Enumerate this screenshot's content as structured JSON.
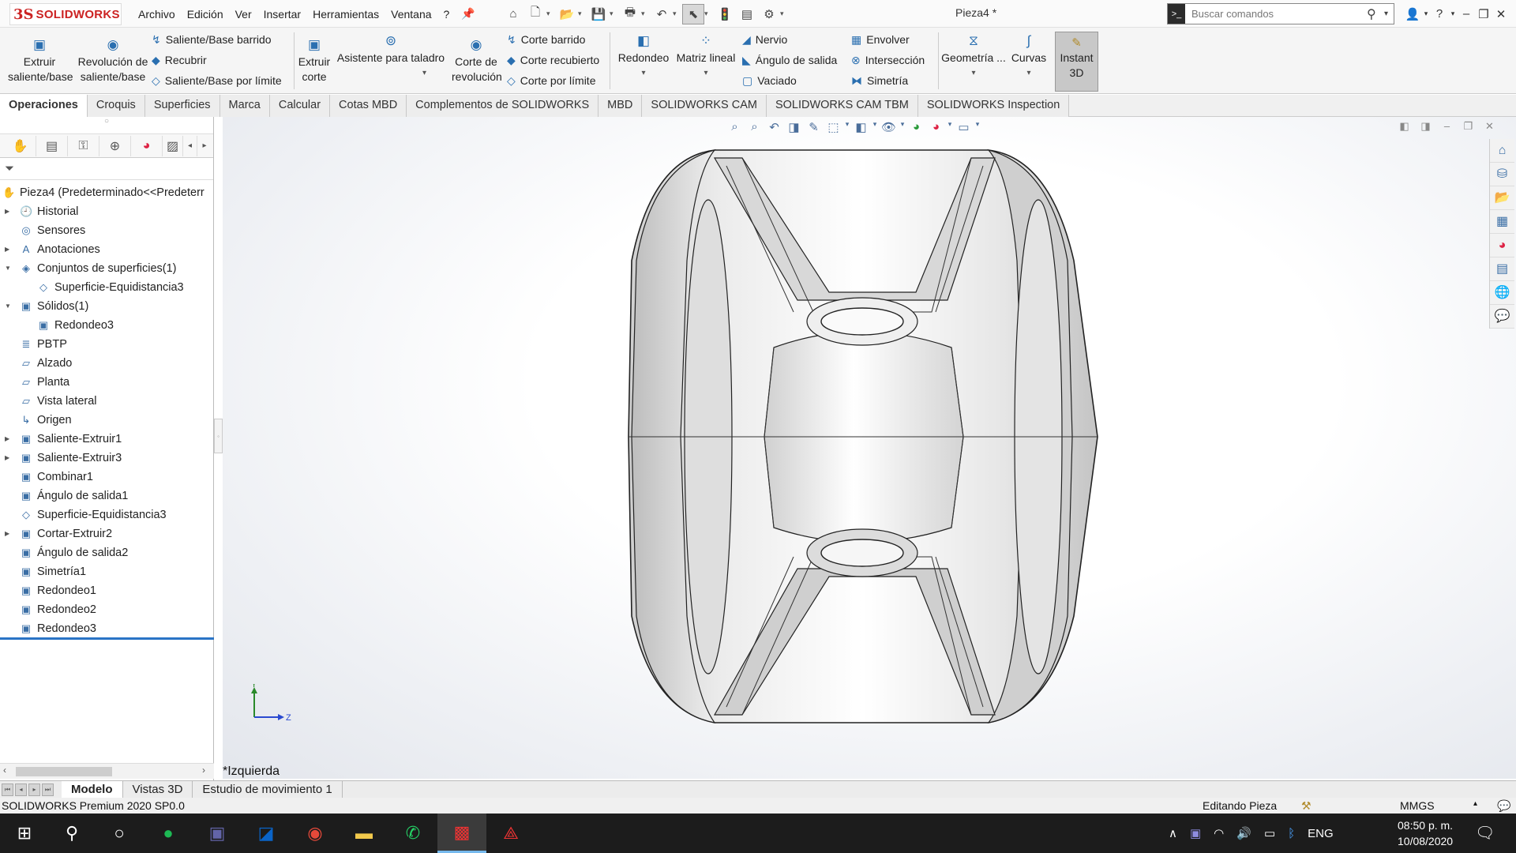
{
  "app": {
    "logo_ds": "3S",
    "logo_text": "SOLIDWORKS",
    "document_title": "Pieza4 *",
    "menus": [
      "Archivo",
      "Edición",
      "Ver",
      "Insertar",
      "Herramientas",
      "Ventana",
      "?"
    ],
    "search_placeholder": "Buscar comandos"
  },
  "command_manager": {
    "extruir": "Extruir saliente/base",
    "revolucion": "Revolución de saliente/base",
    "saliente_barrido": "Saliente/Base barrido",
    "recubrir": "Recubrir",
    "saliente_limite": "Saliente/Base por límite",
    "extruir_corte": "Extruir corte",
    "asistente": "Asistente para taladro",
    "corte_revolucion": "Corte de revolución",
    "corte_barrido": "Corte barrido",
    "corte_recubierto": "Corte recubierto",
    "corte_limite": "Corte por límite",
    "redondeo": "Redondeo",
    "matriz": "Matriz lineal",
    "nervio": "Nervio",
    "angulo_salida": "Ángulo de salida",
    "vaciado": "Vaciado",
    "envolver": "Envolver",
    "interseccion": "Intersección",
    "simetria": "Simetría",
    "geometria": "Geometría ...",
    "curvas": "Curvas",
    "instant3d": "Instant 3D"
  },
  "tabs": [
    "Operaciones",
    "Croquis",
    "Superficies",
    "Marca",
    "Calcular",
    "Cotas MBD",
    "Complementos de SOLIDWORKS",
    "MBD",
    "SOLIDWORKS CAM",
    "SOLIDWORKS CAM TBM",
    "SOLIDWORKS Inspection"
  ],
  "tree": {
    "root": "Pieza4  (Predeterminado<<Predeterr",
    "items": [
      {
        "label": "Historial",
        "arrow": "▶",
        "indent": 0
      },
      {
        "label": "Sensores",
        "arrow": "",
        "indent": 0
      },
      {
        "label": "Anotaciones",
        "arrow": "▶",
        "indent": 0
      },
      {
        "label": "Conjuntos de superficies(1)",
        "arrow": "▼",
        "indent": 0
      },
      {
        "label": "Superficie-Equidistancia3",
        "arrow": "",
        "indent": 1
      },
      {
        "label": "Sólidos(1)",
        "arrow": "▼",
        "indent": 0
      },
      {
        "label": "Redondeo3",
        "arrow": "",
        "indent": 1
      },
      {
        "label": "PBTP",
        "arrow": "",
        "indent": 0
      },
      {
        "label": "Alzado",
        "arrow": "",
        "indent": 0
      },
      {
        "label": "Planta",
        "arrow": "",
        "indent": 0
      },
      {
        "label": "Vista lateral",
        "arrow": "",
        "indent": 0
      },
      {
        "label": "Origen",
        "arrow": "",
        "indent": 0
      },
      {
        "label": "Saliente-Extruir1",
        "arrow": "▶",
        "indent": 0
      },
      {
        "label": "Saliente-Extruir3",
        "arrow": "▶",
        "indent": 0
      },
      {
        "label": "Combinar1",
        "arrow": "",
        "indent": 0
      },
      {
        "label": "Ángulo de salida1",
        "arrow": "",
        "indent": 0
      },
      {
        "label": "Superficie-Equidistancia3",
        "arrow": "",
        "indent": 0
      },
      {
        "label": "Cortar-Extruir2",
        "arrow": "▶",
        "indent": 0
      },
      {
        "label": "Ángulo de salida2",
        "arrow": "",
        "indent": 0
      },
      {
        "label": "Simetría1",
        "arrow": "",
        "indent": 0
      },
      {
        "label": "Redondeo1",
        "arrow": "",
        "indent": 0
      },
      {
        "label": "Redondeo2",
        "arrow": "",
        "indent": 0
      },
      {
        "label": "Redondeo3",
        "arrow": "",
        "indent": 0
      }
    ]
  },
  "viewport": {
    "view_name": "*Izquierda",
    "triad_y": "Y",
    "triad_z": "Z"
  },
  "bottom_tabs": [
    "Modelo",
    "Vistas 3D",
    "Estudio de movimiento 1"
  ],
  "status": {
    "version": "SOLIDWORKS Premium 2020 SP0.0",
    "mode": "Editando Pieza",
    "units": "MMGS"
  },
  "taskbar": {
    "lang": "ENG",
    "time": "08:50 p. m.",
    "date": "10/08/2020"
  }
}
